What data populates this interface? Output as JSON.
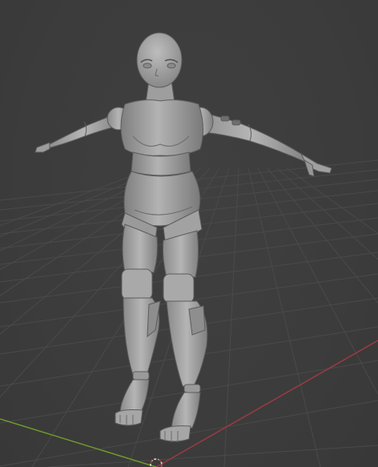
{
  "viewport": {
    "mode": "solid-shading",
    "background_color": "#3d3d3d",
    "grid_color": "#4a4a4a",
    "x_axis_color": "#9b3a44",
    "y_axis_color": "#6f9a2a",
    "model_color": "#9a9a9a"
  },
  "scene": {
    "object": "humanoid-mannequin",
    "pose": "t-pose",
    "origin_marker": "3d-cursor-icon"
  }
}
